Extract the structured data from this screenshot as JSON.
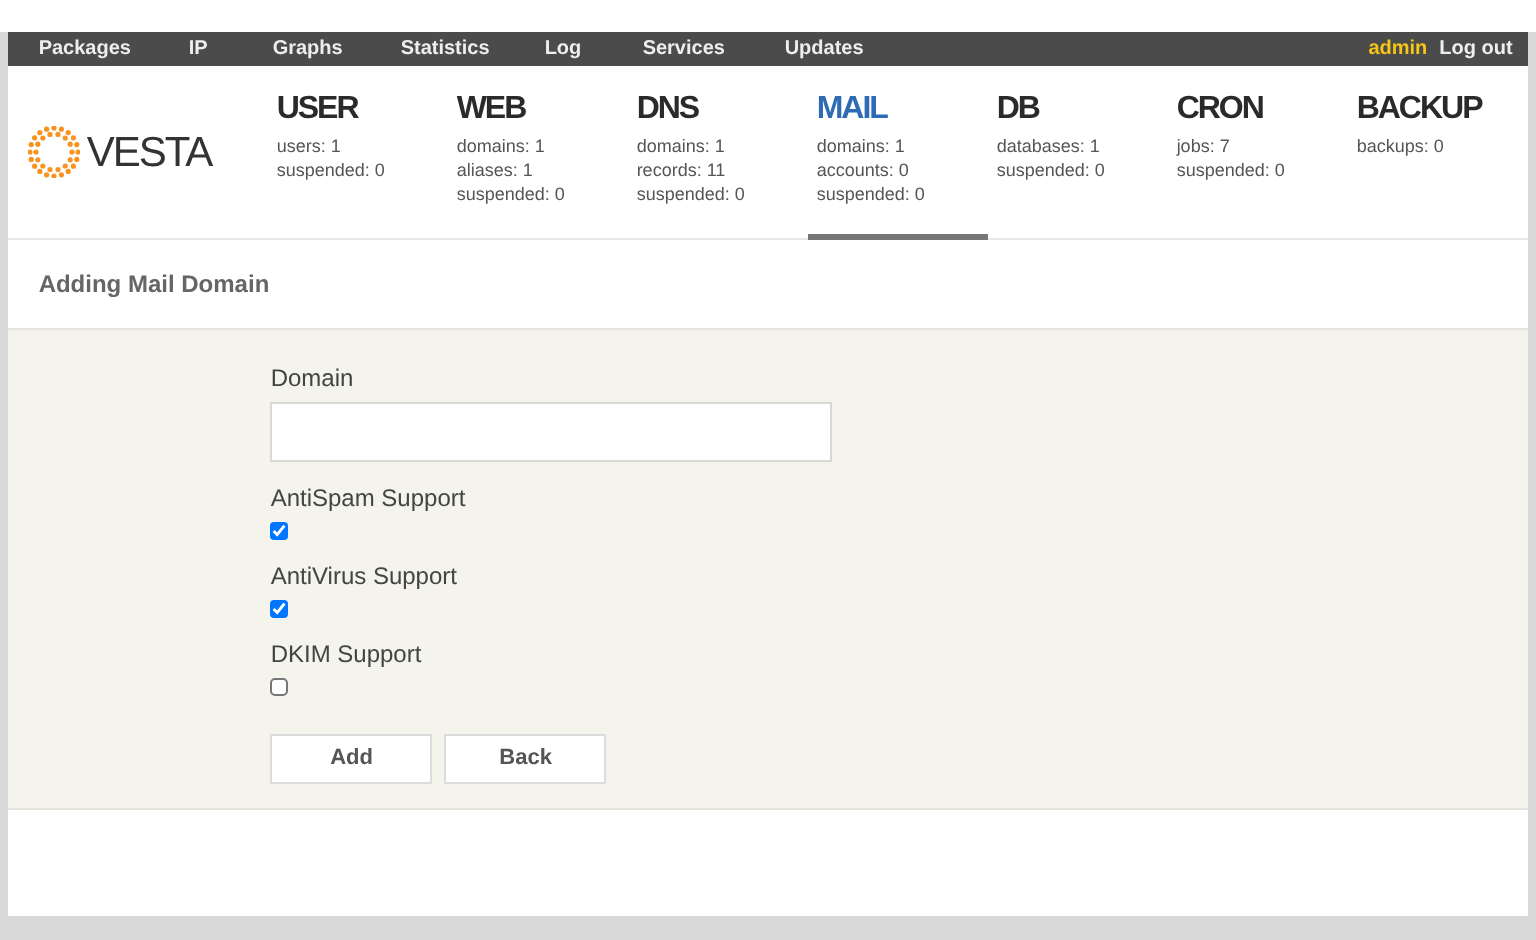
{
  "top_menu": [
    {
      "label": "Packages"
    },
    {
      "label": "IP"
    },
    {
      "label": "Graphs"
    },
    {
      "label": "Statistics"
    },
    {
      "label": "Log"
    },
    {
      "label": "Services"
    },
    {
      "label": "Updates"
    }
  ],
  "user": {
    "name": "admin",
    "logout": "Log out"
  },
  "logo": {
    "text": "VESTA"
  },
  "sections": [
    {
      "title": "USER",
      "selected": false,
      "stats": [
        "users: 1",
        "suspended: 0"
      ]
    },
    {
      "title": "WEB",
      "selected": false,
      "stats": [
        "domains: 1",
        "aliases: 1",
        "suspended: 0"
      ]
    },
    {
      "title": "DNS",
      "selected": false,
      "stats": [
        "domains: 1",
        "records: 11",
        "suspended: 0"
      ]
    },
    {
      "title": "MAIL",
      "selected": true,
      "stats": [
        "domains: 1",
        "accounts: 0",
        "suspended: 0"
      ]
    },
    {
      "title": "DB",
      "selected": false,
      "stats": [
        "databases: 1",
        "suspended: 0"
      ]
    },
    {
      "title": "CRON",
      "selected": false,
      "stats": [
        "jobs: 7",
        "suspended: 0"
      ]
    },
    {
      "title": "BACKUP",
      "selected": false,
      "stats": [
        "backups: 0"
      ]
    }
  ],
  "page_title": "Adding Mail Domain",
  "form": {
    "domain_label": "Domain",
    "options": [
      {
        "label": "AntiSpam Support",
        "checked": true
      },
      {
        "label": "AntiVirus Support",
        "checked": true
      },
      {
        "label": "DKIM Support",
        "checked": false
      }
    ],
    "buttons": [
      "Add",
      "Back"
    ]
  }
}
